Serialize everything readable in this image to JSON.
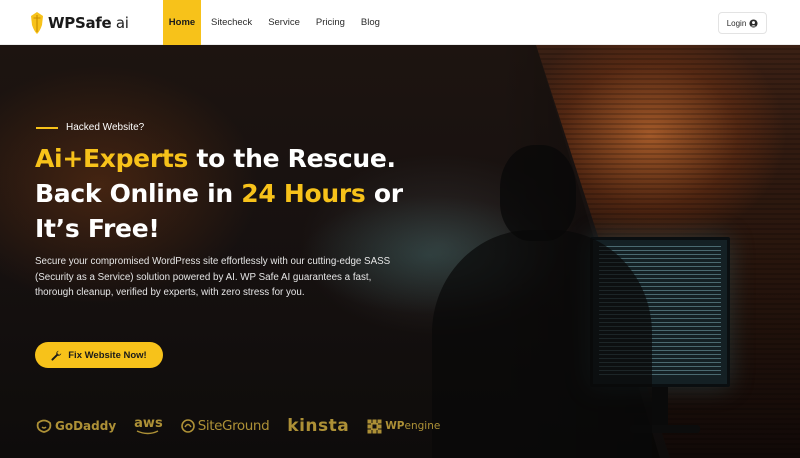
{
  "brand": {
    "name_main": "WPSafe",
    "name_suffix": " ai"
  },
  "nav": {
    "items": [
      {
        "label": "Home",
        "active": true
      },
      {
        "label": "Sitecheck",
        "active": false
      },
      {
        "label": "Service",
        "active": false
      },
      {
        "label": "Pricing",
        "active": false
      },
      {
        "label": "Blog",
        "active": false
      }
    ],
    "login_label": "Login",
    "login_icon": "user-circle-icon"
  },
  "hero": {
    "kicker": "Hacked Website?",
    "headline": {
      "line1_highlight": "Ai+Experts",
      "line1_rest": " to the Rescue.",
      "line2_start": "Back Online in ",
      "line2_highlight": "24 Hours",
      "line2_end": " or",
      "line3_start": "It’s ",
      "line3_bold": "Free",
      "line3_end": "!"
    },
    "description": "Secure your compromised WordPress site effortlessly with our cutting-edge SASS (Security as a Service) solution powered by AI. WP Safe AI guarantees a fast, thorough cleanup, verified by experts, with zero stress for you.",
    "cta_label": "Fix Website Now!",
    "cta_icon": "wrench-icon"
  },
  "partners": [
    {
      "name": "GoDaddy"
    },
    {
      "name": "aws"
    },
    {
      "name": "SiteGround"
    },
    {
      "name": "kinsta"
    },
    {
      "name_bold": "WP",
      "name_rest": "engine"
    }
  ],
  "colors": {
    "accent": "#f7c21a",
    "nav_bg": "#ffffff",
    "hero_bg": "#151110",
    "text_light": "#ffffff"
  }
}
